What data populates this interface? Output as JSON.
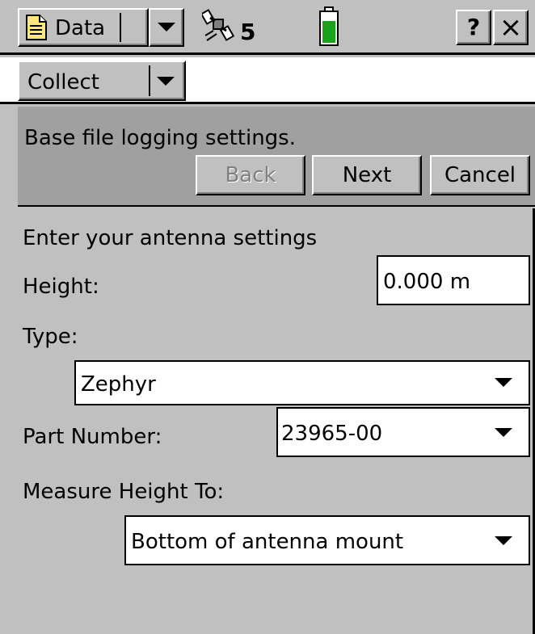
{
  "colors": {
    "panel": "#c0c0c0",
    "header_panel": "#a0a0a0",
    "field_bg": "#ffffff",
    "battery_green": "#1aa31a",
    "disabled_text": "#808080"
  },
  "title_bar": {
    "menu_label": "Data",
    "satellite_count": "5",
    "help_label": "?",
    "close_label": "×"
  },
  "sub_bar": {
    "dropdown_label": "Collect"
  },
  "wizard": {
    "instruction": "Base file logging settings.",
    "back_label": "Back",
    "next_label": "Next",
    "cancel_label": "Cancel"
  },
  "form": {
    "heading": "Enter your antenna settings",
    "height_label": "Height:",
    "height_value": "0.000 m",
    "type_label": "Type:",
    "type_value": "Zephyr",
    "part_label": "Part Number:",
    "part_value": "23965-00",
    "measure_label": "Measure Height To:",
    "measure_value": "Bottom of antenna mount"
  }
}
